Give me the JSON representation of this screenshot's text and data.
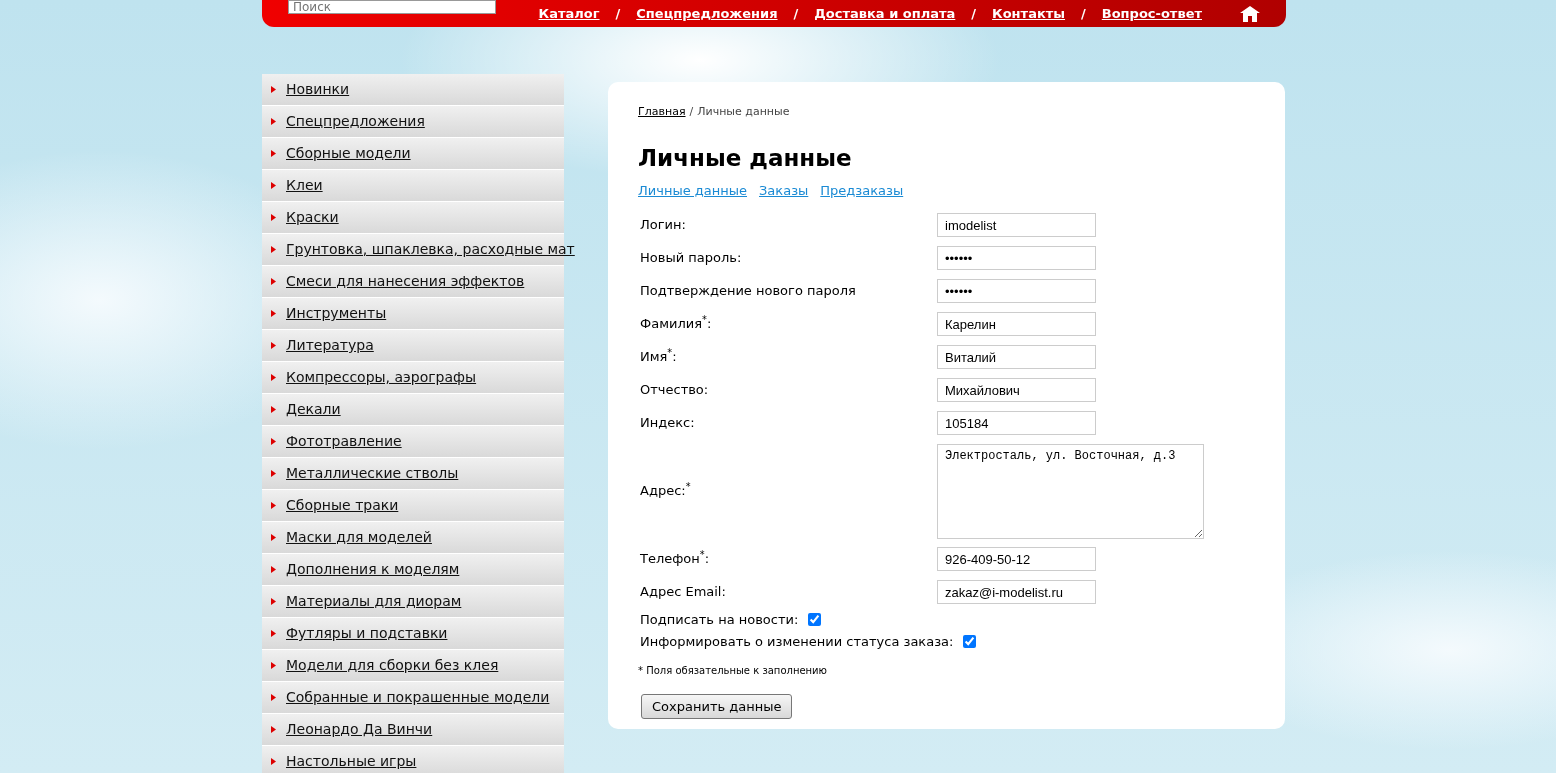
{
  "header": {
    "search": {
      "placeholder": "Поиск"
    },
    "nav_separator": "/",
    "nav": [
      "Каталог",
      "Спецпредложения",
      "Доставка и оплата",
      "Контакты",
      "Вопрос-ответ"
    ]
  },
  "sidebar": {
    "items": [
      "Новинки",
      "Спецпредложения",
      "Сборные модели",
      "Клеи",
      "Краски",
      "Грунтовка, шпаклевка, расходные мат",
      "Смеси для нанесения эффектов",
      "Инструменты",
      "Литература",
      "Компрессоры, аэрографы",
      "Декали",
      "Фототравление",
      "Металлические стволы",
      "Сборные траки",
      "Маски для моделей",
      "Дополнения к моделям",
      "Материалы для диорам",
      "Футляры и подставки",
      "Модели для сборки без клея",
      "Собранные и покрашенные модели",
      "Леонардо Да Винчи",
      "Настольные игры"
    ]
  },
  "breadcrumb": {
    "link": "Главная",
    "separator": "/",
    "current": "Личные данные"
  },
  "title": "Личные данные",
  "tabs": [
    "Личные данные",
    "Заказы",
    "Предзаказы"
  ],
  "fields": [
    {
      "kind": "text",
      "label": "Логин:",
      "value": "imodelist"
    },
    {
      "kind": "text",
      "label": "Новый пароль:",
      "value": "••••••"
    },
    {
      "kind": "text",
      "label": "Подтверждение нового пароля",
      "value": "••••••"
    },
    {
      "kind": "text",
      "label": "Фамилия$^{*}$:",
      "value": "Карелин"
    },
    {
      "kind": "text",
      "label": "Имя$^{*}$:",
      "value": "Виталий"
    },
    {
      "kind": "text",
      "label": "Отчество:",
      "value": "Михайлович"
    },
    {
      "kind": "text",
      "label": "Индекс:",
      "value": "105184"
    },
    {
      "kind": "textarea",
      "label": "Адрес:$^{*}$",
      "value": "Электросталь, ул. Восточная, д.3"
    },
    {
      "kind": "text",
      "label": "Телефон$^{*}$:",
      "value": "926-409-50-12"
    },
    {
      "kind": "text",
      "label": "Адрес Email:",
      "value": "zakaz@i-modelist.ru"
    },
    {
      "kind": "checkbox",
      "label": "Подписать на новости:",
      "checked": true
    },
    {
      "kind": "checkbox",
      "label": "Информировать о изменении статуса заказа:",
      "checked": true
    }
  ],
  "note": "* Поля обязательные к заполнению",
  "save_button": "Сохранить данные"
}
